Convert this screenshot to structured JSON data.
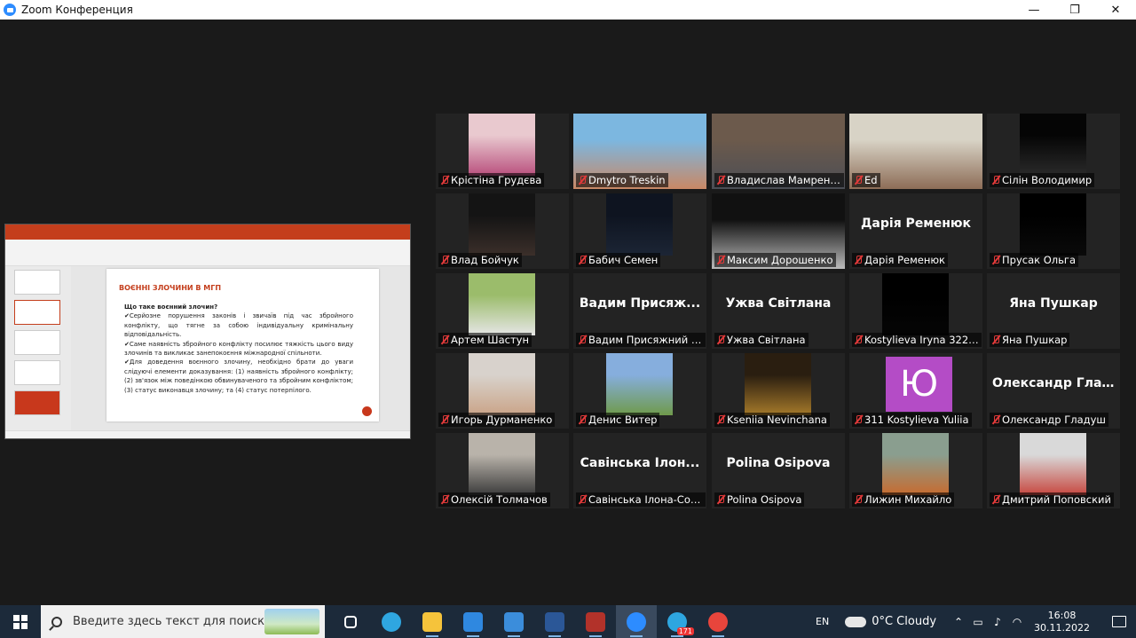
{
  "window": {
    "title": "Zoom Конференция",
    "controls": [
      "—",
      "❐",
      "✕"
    ]
  },
  "slide": {
    "title": "ВОЄННІ ЗЛОЧИНИ В МГП",
    "question": "Що таке воєнний злочин?",
    "p1": "✔Серйозне порушення законів і звичаїв під час збройного конфлікту, що тягне за собою індивідуальну кримінальну відповідальність.",
    "p2": "✔Саме наявність збройного конфлікту посилює тяжкість цього виду злочинів та викликає занепокоєння міжнародної спільноти.",
    "p3": "✔Для доведення воєнного злочину, необхідно брати до уваги слідуючі елементи доказування: (1) наявність збройного конфлікту; (2) зв'язок між поведінкою обвинуваченого та збройним конфліктом; (3) статус виконавця злочину; та (4) статус потерпілого."
  },
  "participants": [
    {
      "name": "Крістіна Грудєва",
      "video": true,
      "colors": [
        "#e9c9cf",
        "#b9507e"
      ]
    },
    {
      "name": "Dmytro Treskin",
      "video": true,
      "colors": [
        "#7cb7e0",
        "#c98865"
      ]
    },
    {
      "name": "Владислав Мамренко",
      "video": true,
      "colors": [
        "#6c5a4c",
        "#4b4e55"
      ]
    },
    {
      "name": "Ed",
      "video": true,
      "active": true,
      "colors": [
        "#d8d3c6",
        "#8d6d57"
      ]
    },
    {
      "name": "Сілін Володимир",
      "video": true,
      "colors": [
        "#050505",
        "#2a2a2a"
      ]
    },
    {
      "name": "Влад Бойчук",
      "video": true,
      "colors": [
        "#141414",
        "#3b2f2a"
      ]
    },
    {
      "name": "Бабич Семен",
      "video": true,
      "colors": [
        "#0e1420",
        "#1c2535"
      ]
    },
    {
      "name": "Максим Дорошенко",
      "video": true,
      "colors": [
        "#111111",
        "#bbbbbb"
      ]
    },
    {
      "name": "Дарія Ременюк",
      "video": false,
      "big": "Дарія Ременюк"
    },
    {
      "name": "Прусак Ольга",
      "video": true,
      "colors": [
        "#000000",
        "#0a0a0a"
      ]
    },
    {
      "name": "Артем Шастун",
      "video": true,
      "colors": [
        "#9bbc6b",
        "#e6e6e6"
      ]
    },
    {
      "name": "Вадим Присяжний Ц...",
      "video": false,
      "big": "Вадим  Присяж..."
    },
    {
      "name": "Ужва Світлана",
      "video": false,
      "big": "Ужва Світлана"
    },
    {
      "name": "Kostylieva Iryna 322 F...",
      "video": true,
      "colors": [
        "#000000",
        "#050505"
      ]
    },
    {
      "name": "Яна Пушкар",
      "video": false,
      "big": "Яна Пушкар"
    },
    {
      "name": "Игорь Дурманенко",
      "video": true,
      "colors": [
        "#d8d2cc",
        "#caa488"
      ]
    },
    {
      "name": "Денис Витер",
      "video": true,
      "colors": [
        "#86aedd",
        "#6f9a4b"
      ]
    },
    {
      "name": "Kseniia Nevinchana",
      "video": true,
      "colors": [
        "#2a1e10",
        "#a67a2a"
      ]
    },
    {
      "name": "311 Kostylieva Yuliia",
      "video": false,
      "avatar": "Ю"
    },
    {
      "name": "Олександр Гладуш",
      "video": false,
      "big": "Олександр  Гла..."
    },
    {
      "name": "Олексій Толмачов",
      "video": true,
      "colors": [
        "#b9b3aa",
        "#3b3b3b"
      ]
    },
    {
      "name": "Савінська Ілона-Сол...",
      "video": false,
      "big": "Савінська  Ілон..."
    },
    {
      "name": "Polina Osipova",
      "video": false,
      "big": "Polina Osipova"
    },
    {
      "name": "Лижин Михайло",
      "video": true,
      "colors": [
        "#8a9e8f",
        "#c76b2f"
      ]
    },
    {
      "name": "Дмитрий Поповский",
      "video": true,
      "colors": [
        "#d9d9d9",
        "#c7473f"
      ]
    }
  ],
  "taskbar": {
    "search_placeholder": "Введите здесь текст для поиска",
    "apps": [
      {
        "name": "task-view-icon",
        "color": "#ffffff"
      },
      {
        "name": "edge-icon",
        "color": "#2fa6e0"
      },
      {
        "name": "file-explorer-icon",
        "color": "#f5c33b"
      },
      {
        "name": "store-icon",
        "color": "#2f88e0"
      },
      {
        "name": "mail-icon",
        "color": "#3b8ddb"
      },
      {
        "name": "word-icon",
        "color": "#2b5797"
      },
      {
        "name": "winrar-icon",
        "color": "#b2322a"
      },
      {
        "name": "zoom-icon",
        "color": "#2d8cff"
      },
      {
        "name": "telegram-icon",
        "color": "#2ea6e0",
        "badge": "171"
      },
      {
        "name": "chrome-icon",
        "color": "#e8453c"
      }
    ],
    "lang": "EN",
    "weather": "0°C  Cloudy",
    "time": "16:08",
    "date": "30.11.2022"
  }
}
